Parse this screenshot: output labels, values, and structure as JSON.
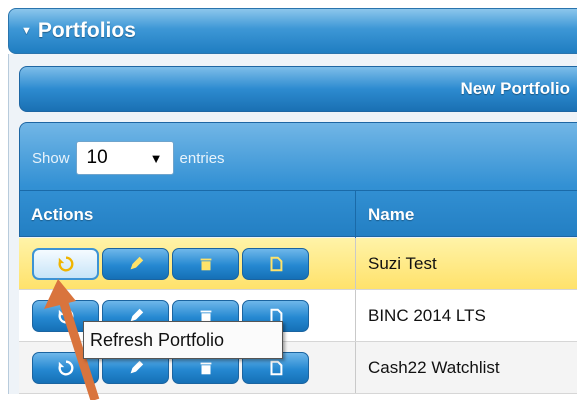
{
  "panel": {
    "title": "Portfolios"
  },
  "toolbar": {
    "new_portfolio_label": "New Portfolio"
  },
  "length_control": {
    "prefix": "Show",
    "selected": "10",
    "suffix": "entries"
  },
  "table": {
    "columns": [
      "Actions",
      "Name"
    ],
    "rows": [
      {
        "name": "Suzi Test"
      },
      {
        "name": "BINC 2014 LTS"
      },
      {
        "name": "Cash22 Watchlist"
      }
    ]
  },
  "tooltip": {
    "text": "Refresh Portfolio"
  },
  "colors": {
    "header_blue": "#2d8bd0",
    "highlight_row": "#ffe26b",
    "icon_yellow": "#ffe36a",
    "annotation_arrow": "#d9743d"
  },
  "icons": [
    "refresh-icon",
    "pencil-icon",
    "trash-icon",
    "document-icon"
  ]
}
